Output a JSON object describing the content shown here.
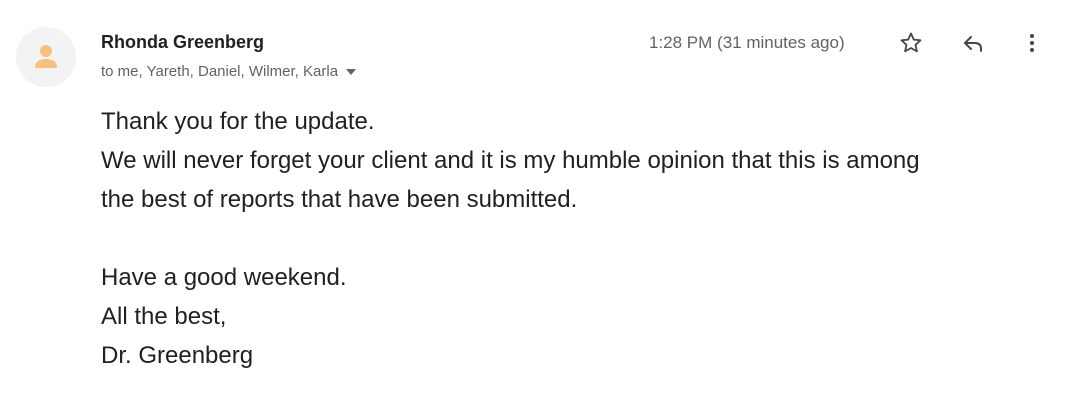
{
  "sender": {
    "name": "Rhonda Greenberg",
    "recipients": "to me, Yareth, Daniel, Wilmer, Karla",
    "avatar_icon": "person-icon",
    "avatar_color": "#f6c17b"
  },
  "header": {
    "timestamp": "1:28 PM (31 minutes ago)",
    "star_icon": "star-outline-icon",
    "reply_icon": "reply-icon",
    "more_icon": "more-vertical-icon"
  },
  "body": {
    "line1": "Thank you for the update.",
    "line2": "We will never forget your client and it is my humble opinion that this is among",
    "line3": "the best of reports that have been submitted.",
    "line4": "Have a good weekend.",
    "line5": "All the best,",
    "line6": "Dr. Greenberg"
  }
}
